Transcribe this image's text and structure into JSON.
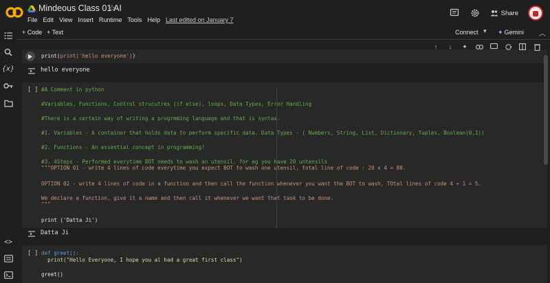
{
  "header": {
    "title": "Mindeous Class 01 AI",
    "menu": [
      "File",
      "Edit",
      "View",
      "Insert",
      "Runtime",
      "Tools",
      "Help"
    ],
    "last_edited": "Last edited on January 7",
    "share_label": "Share"
  },
  "toolbar": {
    "add_code": "+ Code",
    "add_text": "+ Text",
    "connect": "Connect",
    "gemini": "Gemini"
  },
  "cells": [
    {
      "code_lines": [
        "print('hello everyone')"
      ],
      "output": "hello everyone"
    },
    {
      "bracket": "[ ]",
      "code_lines": [
        "#A Comment in python",
        "#Variables, Functions, Control strucutres (if else), loops, Data Types, Error Handling",
        "#There is a certain way of writing a progrmming language and that is syntax.",
        "#1. Variables - A container that holds data to perform specific data. Data Types - ( Numbers, String, List, Dictionary, Tuples, Boolean(0,1))",
        "#2. Functions - An essential concept in programming!",
        "#3. 4Steps - Performed everytime BOT needs to wash an utensil. for eg you have 20 untensils",
        "\"\"\"OPTION 01 - write 4 lines of code everytime you expect BOT to wash one utensil, total line of code : 20 x 4 = 80.",
        "OPTION 02 - write 4 lines of code in a function and then call the function whenever you want the BOT to wash, TOtal lines of code 4 + 1 = 5.",
        "We declare a function, give it a name and then call it whenever we want that task to be done.",
        "\"\"\"",
        "print ('Datta Ji')"
      ],
      "output": "Datta Ji"
    },
    {
      "bracket": "[ ]",
      "code_lines": [
        "def greet():",
        "  print(\"Hello Everyone, I hope you al had a great first class\")",
        "greet()"
      ]
    }
  ],
  "colors": {
    "background": "#1f1f1f",
    "cell": "#282828",
    "comment": "#6aab4b",
    "string": "#ce9178",
    "logo_orange": "#f9ab00"
  },
  "icons": {
    "sidebar": [
      "table-of-contents-icon",
      "search-icon",
      "variables-icon",
      "secrets-key-icon",
      "folder-icon",
      "code-snippets-icon",
      "command-palette-icon",
      "terminal-icon"
    ],
    "cell_toolbar": [
      "move-up-icon",
      "move-down-icon",
      "gemini-spark-icon",
      "link-icon",
      "comment-icon",
      "settings-icon",
      "mirror-cell-icon",
      "delete-icon",
      "more-icon"
    ]
  }
}
